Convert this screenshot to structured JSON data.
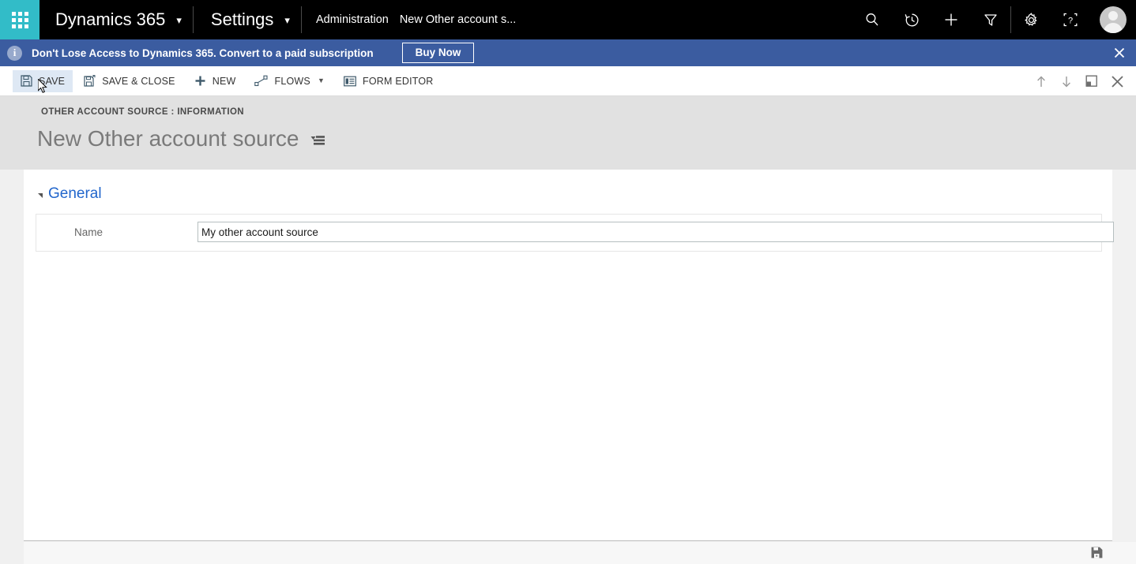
{
  "topnav": {
    "waffle_label": "app-launcher",
    "app_title": "Dynamics 365",
    "area_title": "Settings",
    "breadcrumb": [
      {
        "label": "Administration"
      },
      {
        "label": "New Other account s..."
      }
    ],
    "icons": [
      {
        "name": "search-icon",
        "label": "Search"
      },
      {
        "name": "history-icon",
        "label": "Recently Viewed"
      },
      {
        "name": "quick-create-icon",
        "label": "Quick Create"
      },
      {
        "name": "advanced-find-icon",
        "label": "Advanced Find"
      },
      {
        "name": "settings-gear-icon",
        "label": "Settings"
      },
      {
        "name": "help-icon",
        "label": "Help"
      }
    ],
    "avatar_label": "User profile"
  },
  "notification": {
    "info_glyph": "i",
    "message": "Don't Lose Access to Dynamics 365. Convert to a paid subscription",
    "button_label": "Buy Now",
    "close_label": "✕",
    "background_color": "#3b5ca0"
  },
  "commandbar": {
    "buttons": [
      {
        "name": "save-button",
        "label": "SAVE",
        "icon": "save-icon",
        "hover": true,
        "caret": false
      },
      {
        "name": "save-and-close-button",
        "label": "SAVE & CLOSE",
        "icon": "save-close-icon",
        "hover": false,
        "caret": false
      },
      {
        "name": "new-button",
        "label": "NEW",
        "icon": "plus-icon",
        "hover": false,
        "caret": false
      },
      {
        "name": "flows-button",
        "label": "FLOWS",
        "icon": "flows-icon",
        "hover": false,
        "caret": true
      },
      {
        "name": "form-editor-button",
        "label": "FORM EDITOR",
        "icon": "form-editor-icon",
        "hover": false,
        "caret": false
      }
    ],
    "right_icons": [
      {
        "name": "previous-record-icon",
        "label": "Up"
      },
      {
        "name": "next-record-icon",
        "label": "Down"
      },
      {
        "name": "pop-out-icon",
        "label": "Pop out"
      },
      {
        "name": "close-form-icon",
        "label": "Close"
      }
    ]
  },
  "page": {
    "eyebrow": "OTHER ACCOUNT SOURCE : INFORMATION",
    "title": "New Other account source",
    "form_selector_label": "form-selector"
  },
  "form": {
    "section_title": "General",
    "fields": [
      {
        "name": "name-field",
        "label": "Name",
        "value": "My other account source",
        "placeholder": ""
      }
    ]
  },
  "statusbar": {
    "save_icon_label": "save-status-icon"
  },
  "colors": {
    "waffle_teal": "#32bcc8",
    "topnav_black": "#000000",
    "notification_blue": "#3b5ca0",
    "header_gray": "#e1e1e1",
    "section_link_blue": "#2266cc",
    "hover_blue": "#dee8f4"
  }
}
